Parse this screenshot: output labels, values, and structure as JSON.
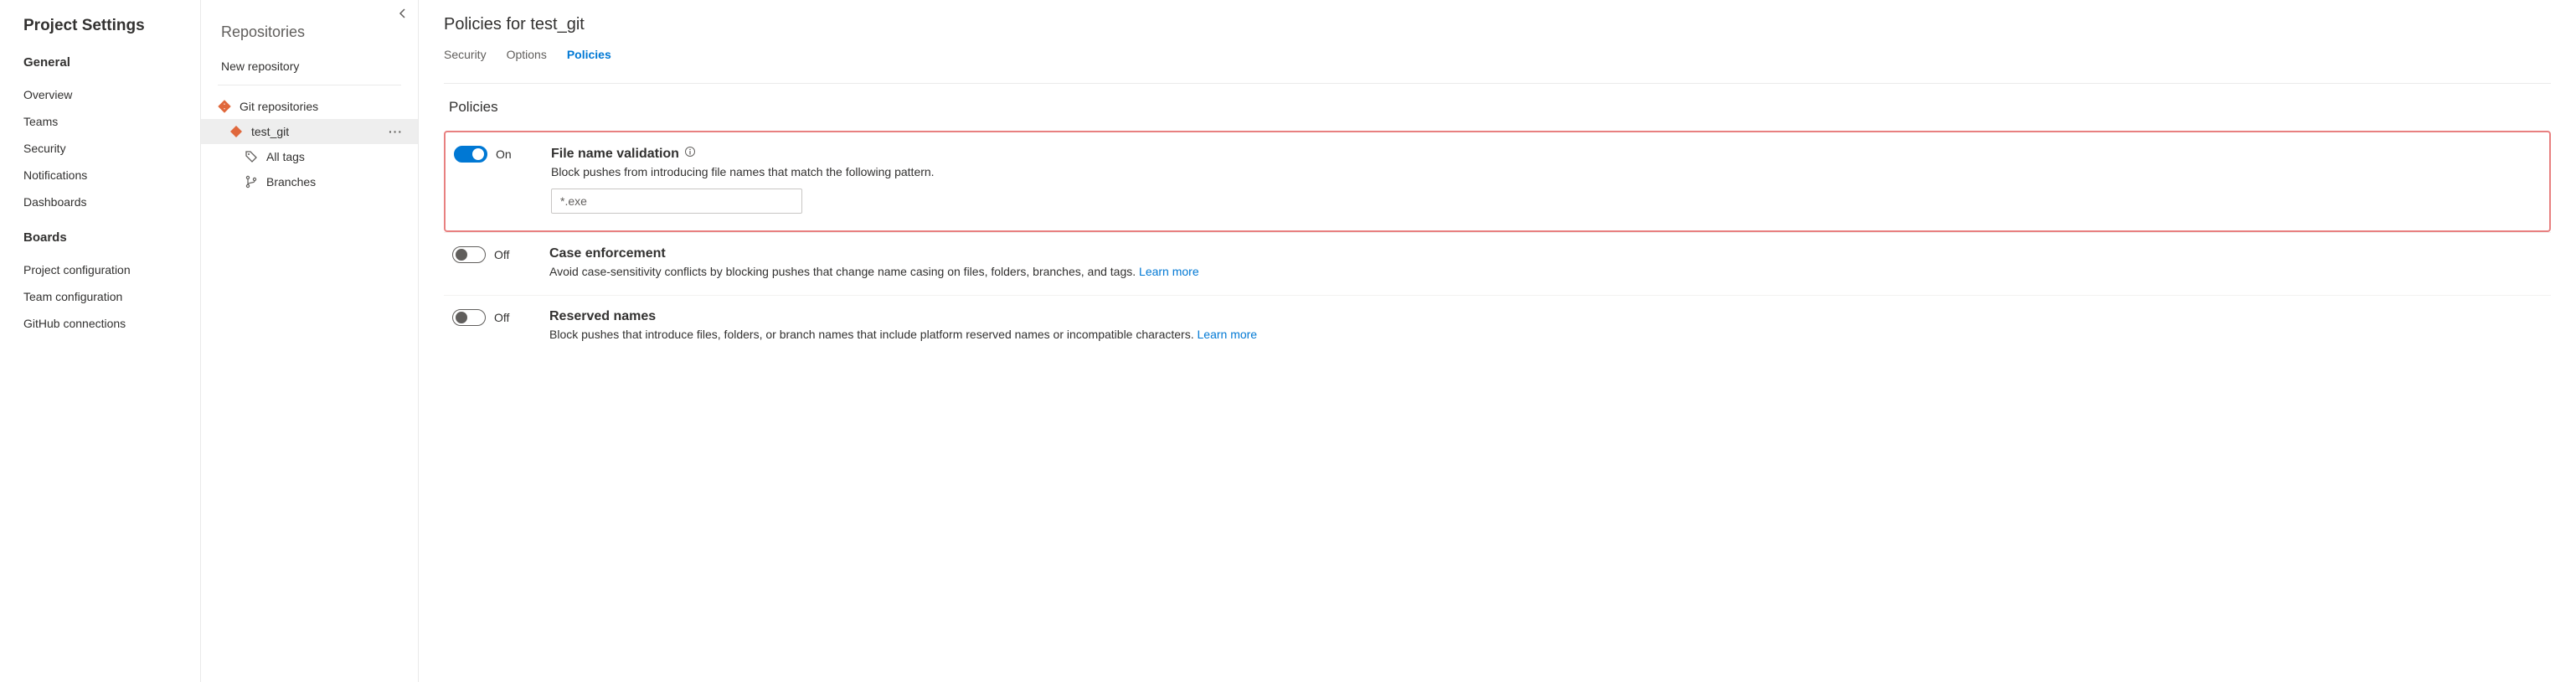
{
  "left": {
    "title": "Project Settings",
    "sections": [
      {
        "header": "General",
        "items": [
          "Overview",
          "Teams",
          "Security",
          "Notifications",
          "Dashboards"
        ]
      },
      {
        "header": "Boards",
        "items": [
          "Project configuration",
          "Team configuration",
          "GitHub connections"
        ]
      }
    ]
  },
  "mid": {
    "title": "Repositories",
    "new_repo": "New repository",
    "tree": {
      "root": {
        "label": "Git repositories"
      },
      "repo": {
        "label": "test_git"
      },
      "all_tags": {
        "label": "All tags"
      },
      "branches": {
        "label": "Branches"
      }
    }
  },
  "main": {
    "title": "Policies for test_git",
    "tabs": {
      "security": "Security",
      "options": "Options",
      "policies": "Policies"
    },
    "panel_title": "Policies",
    "policies": {
      "file_name": {
        "state": "On",
        "name": "File name validation",
        "desc": "Block pushes from introducing file names that match the following pattern.",
        "value": "*.exe"
      },
      "case_enf": {
        "state": "Off",
        "name": "Case enforcement",
        "desc": "Avoid case-sensitivity conflicts by blocking pushes that change name casing on files, folders, branches, and tags. ",
        "learn": "Learn more"
      },
      "reserved": {
        "state": "Off",
        "name": "Reserved names",
        "desc": "Block pushes that introduce files, folders, or branch names that include platform reserved names or incompatible characters. ",
        "learn": "Learn more"
      }
    }
  }
}
